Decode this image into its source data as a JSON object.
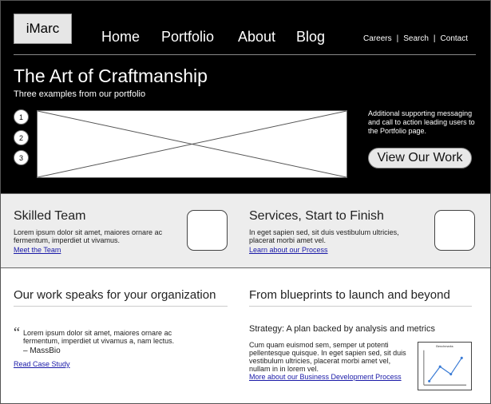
{
  "header": {
    "logo": "iMarc",
    "nav": [
      {
        "label": "Home"
      },
      {
        "label": "Portfolio"
      },
      {
        "label": "About"
      },
      {
        "label": "Blog"
      }
    ],
    "utility": [
      {
        "label": "Careers"
      },
      {
        "label": "Search"
      },
      {
        "label": "Contact"
      }
    ],
    "separator": "|"
  },
  "hero": {
    "title": "The Art of Craftmanship",
    "subtitle": "Three examples from our portfolio",
    "pager": [
      "1",
      "2",
      "3"
    ],
    "message": "Additional supporting messaging and call to action leading users to the Portfolio page.",
    "cta": "View Our Work"
  },
  "features": {
    "left": {
      "title": "Skilled Team",
      "text": "Lorem ipsum dolor sit amet, maiores ornare ac fermentum, imperdiet ut vivamus.",
      "link": "Meet the Team"
    },
    "right": {
      "title": "Services, Start to Finish",
      "text": "In eget sapien sed, sit duis vestibulum ultricies, placerat morbi amet vel.",
      "link": "Learn about our Process"
    }
  },
  "work": {
    "title": "Our work speaks for your organization",
    "quote_mark": "“",
    "quote": "Lorem ipsum dolor sit amet, maiores ornare ac fermentum, imperdiet ut vivamus a, nam lectus.",
    "attribution": "– MassBio",
    "link": "Read Case Study"
  },
  "blueprints": {
    "title": "From blueprints to launch and beyond",
    "subtitle": "Strategy: A plan backed by analysis and metrics",
    "text": "Cum quam euismod sem, semper ut potenti pellentesque quisque. In eget sapien sed, sit duis vestibulum ultricies, placerat morbi amet vel, nullam in in lorem vel.",
    "link": "More about our Business Development Process",
    "chart_title": "Benchmarks",
    "chart_points": [
      1,
      3.5,
      2.2,
      5
    ]
  },
  "colors": {
    "hero_bg": "#000000",
    "band_bg": "#ededed",
    "link": "#1a1aa8",
    "chart_line": "#3a7bd5"
  }
}
